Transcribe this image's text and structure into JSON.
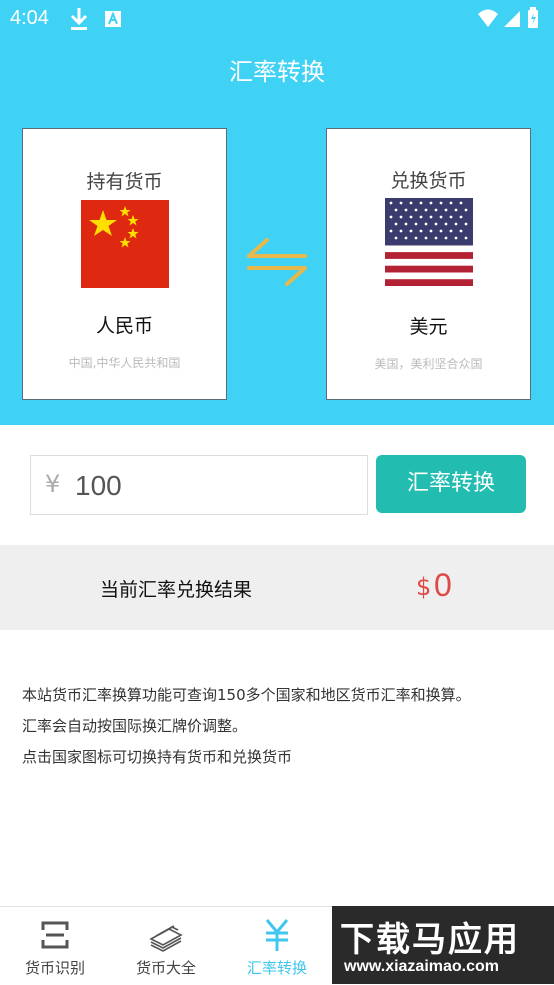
{
  "status_bar": {
    "time": "4:04"
  },
  "header": {
    "title": "汇率转换"
  },
  "from_card": {
    "label": "持有货币",
    "currency": "人民币",
    "description": "中国,中华人民共和国",
    "flag": "china-flag"
  },
  "to_card": {
    "label": "兑换货币",
    "currency": "美元",
    "description": "美国，美利坚合众国",
    "flag": "usa-flag"
  },
  "amount_input": {
    "symbol": "¥",
    "value": "100"
  },
  "convert_button": {
    "label": "汇率转换"
  },
  "result": {
    "label": "当前汇率兑换结果",
    "symbol": "$",
    "value": "0"
  },
  "info_lines": [
    "本站货币汇率换算功能可查询150多个国家和地区货币汇率和换算。",
    "汇率会自动按国际换汇牌价调整。",
    "点击国家图标可切换持有货币和兑换货币"
  ],
  "bottom_nav": [
    {
      "label": "货币识别",
      "icon": "scan-icon"
    },
    {
      "label": "货币大全",
      "icon": "money-stack-icon"
    },
    {
      "label": "汇率转换",
      "icon": "yen-icon",
      "active": true
    }
  ],
  "watermark": {
    "title": "下载马应用",
    "url": "www.xiazaimao.com"
  },
  "colors": {
    "primary": "#3fd2f5",
    "button": "#22bdb0",
    "result": "#e04848",
    "swap_arrows": "#e8b84a"
  }
}
